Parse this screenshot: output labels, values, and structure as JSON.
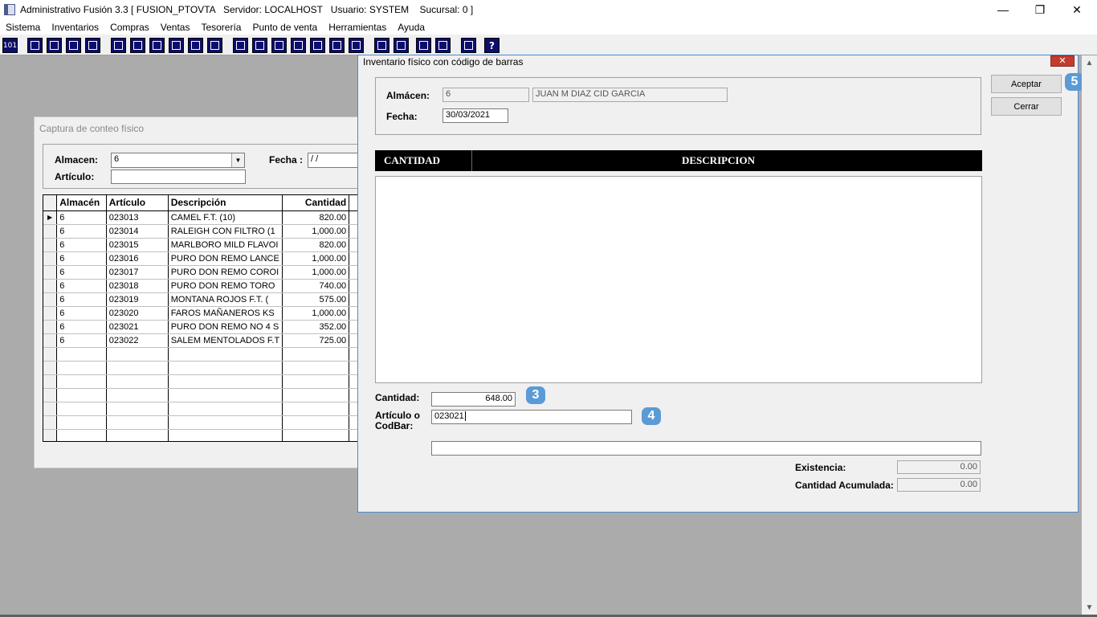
{
  "app": {
    "title": "Administrativo Fusión 3.3 [ FUSION_PTOVTA   Servidor: LOCALHOST   Usuario: SYSTEM    Sucursal: 0 ]",
    "minimize": "—",
    "restore": "❐",
    "close": "✕"
  },
  "menu": [
    "Sistema",
    "Inventarios",
    "Compras",
    "Ventas",
    "Tesorería",
    "Punto de venta",
    "Herramientas",
    "Ayuda"
  ],
  "toolbar": {
    "first_label": "101",
    "icons": [
      "calculator-icon",
      "clipboard-icon",
      "exchange-icon",
      "search-icon",
      "user-icon",
      "folder-icon",
      "export-icon",
      "print-icon",
      "document-icon",
      "table-icon",
      "columns-icon",
      "window-icon",
      "import-icon",
      "add-icon",
      "dollar-icon",
      "report-icon",
      "list-icon",
      "home-icon",
      "find-icon",
      "refresh-icon",
      "undo-icon",
      "back-icon",
      "help-icon"
    ],
    "help_label": "?"
  },
  "capture": {
    "title": "Captura de conteo físico",
    "almacen_label": "Almacen:",
    "almacen_value": "6",
    "fecha_label": "Fecha :",
    "fecha_value": "/ /",
    "articulo_label": "Artículo:",
    "articulo_value": "",
    "columns": [
      "Almacén",
      "Artículo",
      "Descripción",
      "Cantidad"
    ],
    "rows": [
      {
        "almacen": "6",
        "articulo": "023013",
        "descripcion": "CAMEL F.T. (10)",
        "cantidad": "820.00"
      },
      {
        "almacen": "6",
        "articulo": "023014",
        "descripcion": "RALEIGH CON FILTRO (1",
        "cantidad": "1,000.00"
      },
      {
        "almacen": "6",
        "articulo": "023015",
        "descripcion": "MARLBORO MILD FLAVOI",
        "cantidad": "820.00"
      },
      {
        "almacen": "6",
        "articulo": "023016",
        "descripcion": "PURO DON REMO LANCE",
        "cantidad": "1,000.00"
      },
      {
        "almacen": "6",
        "articulo": "023017",
        "descripcion": "PURO DON REMO COROI",
        "cantidad": "1,000.00"
      },
      {
        "almacen": "6",
        "articulo": "023018",
        "descripcion": "PURO DON REMO TORO",
        "cantidad": "740.00"
      },
      {
        "almacen": "6",
        "articulo": "023019",
        "descripcion": "MONTANA ROJOS F.T. (",
        "cantidad": "575.00"
      },
      {
        "almacen": "6",
        "articulo": "023020",
        "descripcion": "FAROS MAÑANEROS KS",
        "cantidad": "1,000.00"
      },
      {
        "almacen": "6",
        "articulo": "023021",
        "descripcion": "PURO DON REMO NO 4 S",
        "cantidad": "352.00"
      },
      {
        "almacen": "6",
        "articulo": "023022",
        "descripcion": "SALEM MENTOLADOS F.T",
        "cantidad": "725.00"
      }
    ]
  },
  "dialog": {
    "title": "Inventario físico con código de barras",
    "close_glyph": "✕",
    "almacen_label": "Almácen:",
    "almacen_code": "6",
    "almacen_name": "JUAN M DIAZ CID GARCIA",
    "fecha_label": "Fecha:",
    "fecha_value": "30/03/2021",
    "accept_label": "Aceptar",
    "close_label": "Cerrar",
    "col_cantidad": "CANTIDAD",
    "col_descripcion": "DESCRIPCION",
    "cantidad_label": "Cantidad:",
    "cantidad_value": "648.00",
    "articulo_label_1": "Artículo o",
    "articulo_label_2": "CodBar:",
    "articulo_value": "023021",
    "description_value": "",
    "existencia_label": "Existencia:",
    "existencia_value": "0.00",
    "acumulada_label": "Cantidad Acumulada:",
    "acumulada_value": "0.00",
    "badges": {
      "cantidad": "3",
      "articulo": "4",
      "accept": "5"
    }
  },
  "scroll": {
    "up": "▲",
    "down": "▼"
  },
  "colors": {
    "header_bg": "#000000",
    "badge": "#5b9bd5",
    "mdi_bg": "#ababab",
    "toolbar_btn": "#0d0d6b"
  }
}
